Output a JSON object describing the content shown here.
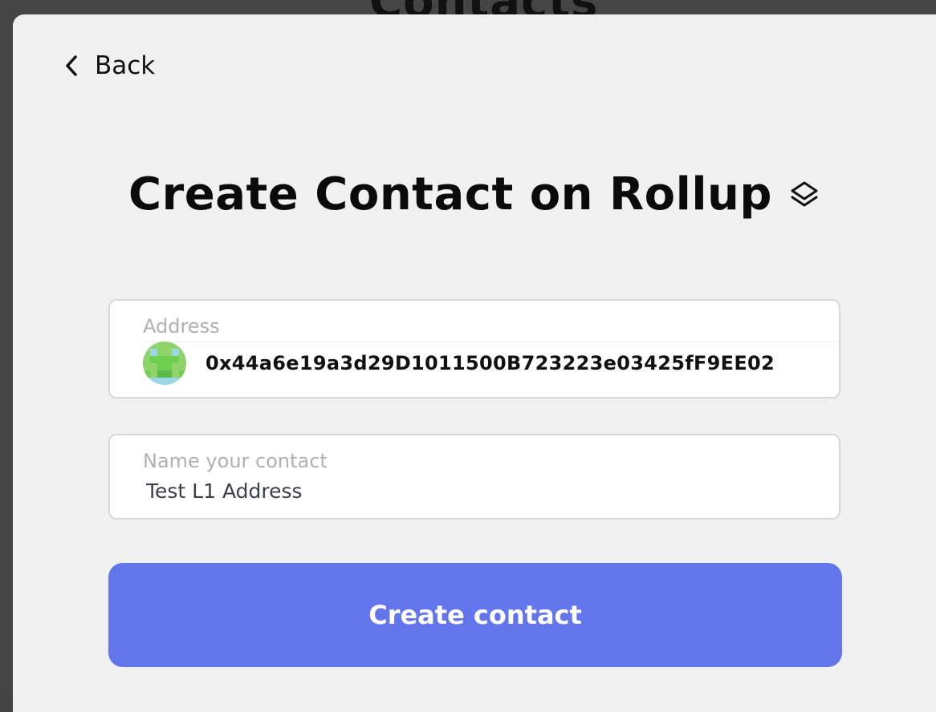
{
  "background": {
    "title": "Contacts"
  },
  "modal": {
    "back_label": "Back",
    "title": "Create Contact on Rollup",
    "title_icon": "layers-icon"
  },
  "address_field": {
    "label": "Address",
    "value": "0x44a6e19a3d29D1011500B723223e03425fF9EE02",
    "avatar_icon": "identicon-avatar"
  },
  "name_field": {
    "label": "Name your contact",
    "value": "Test L1 Address"
  },
  "create_button": {
    "label": "Create contact"
  },
  "colors": {
    "accent": "#6375ea",
    "modal_bg": "#f0f0f0",
    "backdrop": "#454545",
    "label_gray": "#b0b0b0"
  }
}
